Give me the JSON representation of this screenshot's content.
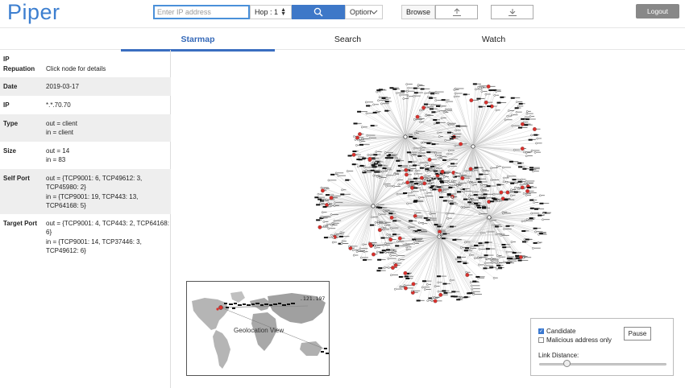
{
  "header": {
    "logo": "Piper",
    "ip_placeholder": "Enter IP address",
    "hop_label": "Hop : 1",
    "option_label": "Option",
    "browse_label": "Browse",
    "logout_label": "Logout"
  },
  "tabs": [
    {
      "label": "Starmap",
      "active": true
    },
    {
      "label": "Search",
      "active": false
    },
    {
      "label": "Watch",
      "active": false
    }
  ],
  "details": {
    "rows": [
      {
        "key": "IP Repuation",
        "key_lines": [
          "IP",
          "Repuation"
        ],
        "value_lines": [
          "Click node for details"
        ]
      },
      {
        "key": "Date",
        "value_lines": [
          "2019-03-17"
        ]
      },
      {
        "key": "IP",
        "value_lines": [
          "*.*.70.70"
        ]
      },
      {
        "key": "Type",
        "value_lines": [
          "out = client",
          "in = client"
        ]
      },
      {
        "key": "Size",
        "value_lines": [
          "out = 14",
          "in = 83"
        ]
      },
      {
        "key": "Self Port",
        "value_lines": [
          "out = {TCP9001: 6, TCP49612: 3,",
          "TCP45980: 2}",
          "in = {TCP9001: 19, TCP443: 13,",
          "TCP64168: 5}"
        ]
      },
      {
        "key": "Target Port",
        "value_lines": [
          "out = {TCP9001: 4, TCP443: 2, TCP64168:",
          "6}",
          "in = {TCP9001: 14, TCP37446: 3,",
          "TCP49612: 6}"
        ]
      }
    ]
  },
  "map": {
    "label": "Geolocation View",
    "ip_text": ".121.197"
  },
  "controls": {
    "candidate_label": "Candidate",
    "candidate_checked": true,
    "malicious_label": "Malicious address only",
    "malicious_checked": false,
    "pause_label": "Pause",
    "link_distance_label": "Link Distance:",
    "link_distance_level": 0.22
  },
  "colors": {
    "logo": "#3d7fd0",
    "accent": "#3e78c8",
    "node_red": "#d9302c",
    "node_black": "#111111"
  },
  "icons": {
    "search": "search-icon",
    "upload": "upload-icon",
    "download": "download-icon",
    "chevron": "chevron-down-icon"
  }
}
